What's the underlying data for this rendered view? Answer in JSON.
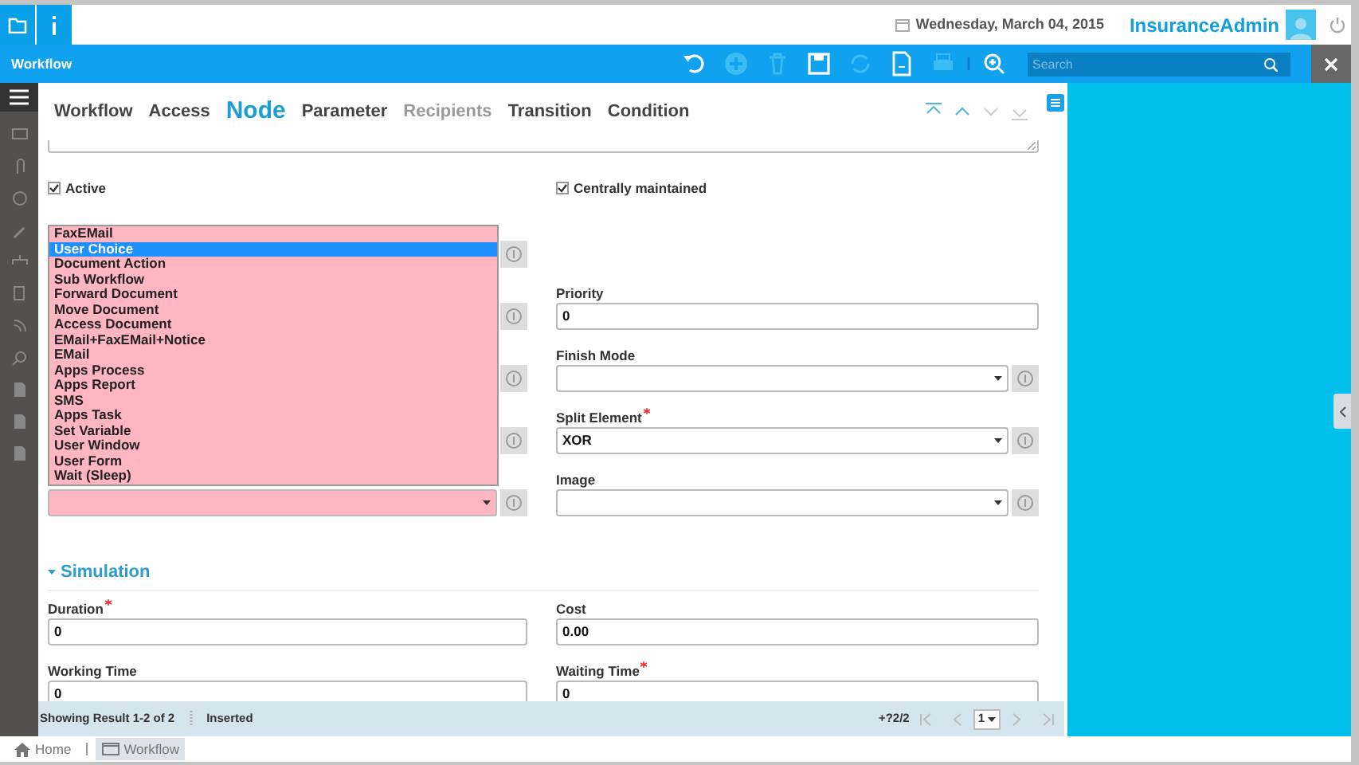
{
  "header": {
    "date": "Wednesday, March 04, 2015",
    "user": "InsuranceAdmin"
  },
  "toolbar": {
    "title": "Workflow",
    "actions": [
      {
        "kind": "undo",
        "disabled": false
      },
      {
        "kind": "new",
        "disabled": true
      },
      {
        "kind": "delete",
        "disabled": true
      },
      {
        "kind": "save",
        "disabled": false
      },
      {
        "kind": "refresh",
        "disabled": true
      },
      {
        "kind": "report",
        "disabled": false
      },
      {
        "kind": "print",
        "disabled": true
      },
      {
        "kind": "zoom",
        "disabled": false
      }
    ],
    "search": {
      "placeholder": "Search"
    }
  },
  "tabs": [
    {
      "label": "Workflow",
      "selected": false,
      "disabled": false
    },
    {
      "label": "Access",
      "selected": false,
      "disabled": false
    },
    {
      "label": "Node",
      "selected": true,
      "disabled": false
    },
    {
      "label": "Parameter",
      "selected": false,
      "disabled": false
    },
    {
      "label": "Recipients",
      "selected": false,
      "disabled": true
    },
    {
      "label": "Transition",
      "selected": false,
      "disabled": false
    },
    {
      "label": "Condition",
      "selected": false,
      "disabled": false
    }
  ],
  "navigation": [
    {
      "kind": "first",
      "disabled": false
    },
    {
      "kind": "previous",
      "disabled": false
    },
    {
      "kind": "next",
      "disabled": true
    },
    {
      "kind": "last",
      "disabled": true
    }
  ],
  "checkboxes": [
    {
      "label": "Active",
      "checked": true
    },
    {
      "label": "Centrally maintained",
      "checked": true
    }
  ],
  "left_fields": [
    {
      "kind": "covered"
    },
    {
      "kind": "covered"
    },
    {
      "kind": "covered"
    },
    {
      "kind": "covered"
    },
    {
      "kind": "select",
      "mandatory": true
    }
  ],
  "entity_type_list": {
    "options": [
      {
        "label": "FaxEMail",
        "selected": false
      },
      {
        "label": "User Choice",
        "selected": true
      },
      {
        "label": "Document Action",
        "selected": false
      },
      {
        "label": "Sub Workflow",
        "selected": false
      },
      {
        "label": "Forward Document",
        "selected": false
      },
      {
        "label": "Move Document",
        "selected": false
      },
      {
        "label": "Access Document",
        "selected": false
      },
      {
        "label": "EMail+FaxEMail+Notice",
        "selected": false
      },
      {
        "label": "EMail",
        "selected": false
      },
      {
        "label": "Apps Process",
        "selected": false
      },
      {
        "label": "Apps Report",
        "selected": false
      },
      {
        "label": "SMS",
        "selected": false
      },
      {
        "label": "Apps Task",
        "selected": false
      },
      {
        "label": "Set Variable",
        "selected": false
      },
      {
        "label": "User Window",
        "selected": false
      },
      {
        "label": "User Form",
        "selected": false
      },
      {
        "label": "Wait (Sleep)",
        "selected": false
      }
    ]
  },
  "right_fields": [
    {
      "kind": "empty"
    },
    {
      "kind": "text",
      "label": "Priority",
      "required": false,
      "value": "0"
    },
    {
      "kind": "select",
      "label": "Finish Mode",
      "required": false
    },
    {
      "kind": "select",
      "label": "Split Element",
      "required": true,
      "value": "XOR"
    },
    {
      "kind": "select",
      "label": "Image",
      "required": false
    }
  ],
  "simulation": {
    "title": "Simulation",
    "expanded": true,
    "fields": [
      {
        "label": "Duration",
        "required": true,
        "value": "0"
      },
      {
        "label": "Cost",
        "required": false,
        "value": "0.00"
      },
      {
        "label": "Working Time",
        "required": false,
        "value": "0"
      },
      {
        "label": "Waiting Time",
        "required": true,
        "value": "0"
      }
    ]
  },
  "status_bar": {
    "result": "Showing Result 1-2 of 2",
    "message": "Inserted",
    "record": "+?2/2",
    "page": "1"
  },
  "footer": [
    {
      "label": "Home",
      "kind": "home",
      "selected": false
    },
    {
      "label": "Workflow",
      "kind": "window",
      "selected": true
    }
  ]
}
